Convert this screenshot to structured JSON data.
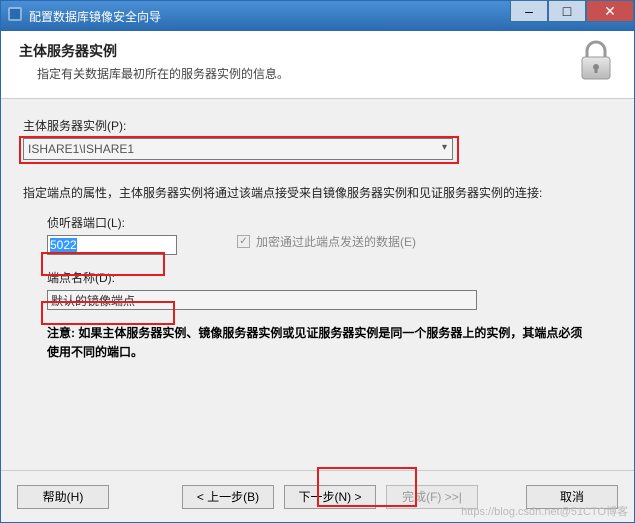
{
  "window": {
    "title": "配置数据库镜像安全向导"
  },
  "header": {
    "title": "主体服务器实例",
    "desc": "指定有关数据库最初所在的服务器实例的信息。"
  },
  "fields": {
    "instance_label": "主体服务器实例(P):",
    "instance_value": "ISHARE1\\ISHARE1",
    "endpoint_desc": "指定端点的属性，主体服务器实例将通过该端点接受来自镜像服务器实例和见证服务器实例的连接:",
    "port_label": "侦听器端口(L):",
    "port_value": "5022",
    "encrypt_label": "加密通过此端点发送的数据(E)",
    "endpoint_label": "端点名称(D):",
    "endpoint_value": "默认的镜像端点",
    "note": "注意: 如果主体服务器实例、镜像服务器实例或见证服务器实例是同一个服务器上的实例，其端点必须使用不同的端口。"
  },
  "buttons": {
    "help": "帮助(H)",
    "back": "< 上一步(B)",
    "next": "下一步(N) >",
    "finish": "完成(F) >>|",
    "cancel": "取消"
  },
  "watermark": "https://blog.csdn.net@51CTO博客"
}
